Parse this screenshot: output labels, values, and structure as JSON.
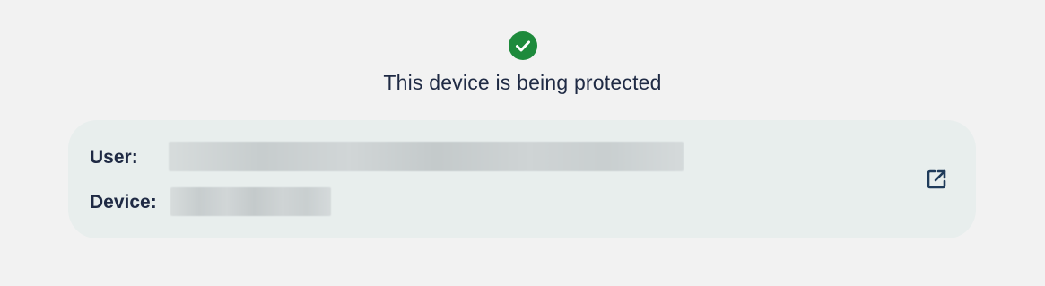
{
  "status": {
    "icon": "check-circle-icon",
    "text": "This device is being protected",
    "accent_color": "#1e8a3c"
  },
  "details": {
    "user_label": "User:",
    "device_label": "Device:",
    "user_value_redacted": true,
    "device_value_redacted": true,
    "open_icon": "external-link-icon"
  }
}
